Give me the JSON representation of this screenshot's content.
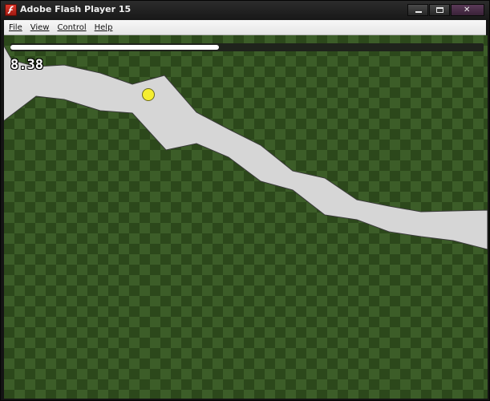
{
  "window": {
    "title": "Adobe Flash Player 15",
    "icon": "flash-player-icon",
    "controls": {
      "minimize": "minimize-icon",
      "maximize": "maximize-icon",
      "close": "close-icon"
    }
  },
  "menu": {
    "items": [
      "File",
      "View",
      "Control",
      "Help"
    ]
  },
  "game": {
    "timer": "8.38",
    "progress_fraction": 0.44,
    "colors": {
      "checker_light": "#3c5d28",
      "checker_dark": "#2c481b",
      "path": "#d6d6d6",
      "ball": "#f5ee31",
      "progress_fill": "#ffffff",
      "progress_track": "#1f231c"
    }
  }
}
